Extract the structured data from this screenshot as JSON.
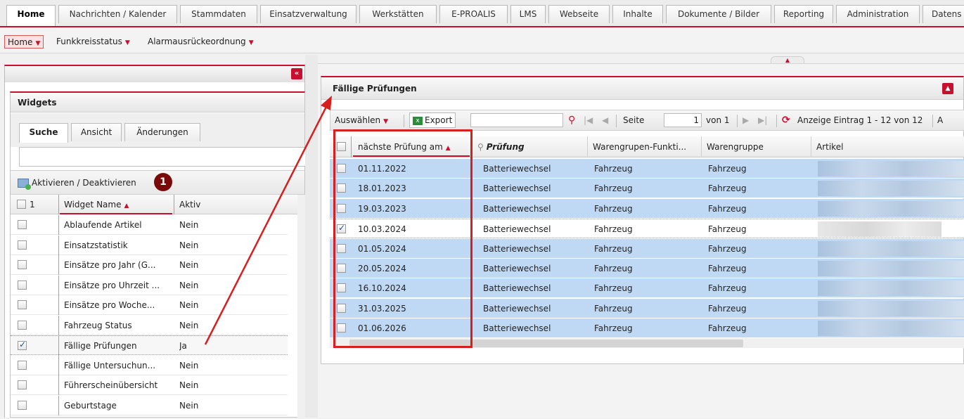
{
  "top_tabs": [
    "Home",
    "Nachrichten / Kalender",
    "Stammdaten",
    "Einsatzverwaltung",
    "Werkstätten",
    "E-PROALIS",
    "LMS",
    "Webseite",
    "Inhalte",
    "Dokumente / Bilder",
    "Reporting",
    "Administration",
    "Datens"
  ],
  "subnav": {
    "home": "Home",
    "funk": "Funkkreisstatus",
    "alarm": "Alarmausrückeordnung"
  },
  "left_panel": {
    "collapse_glyph": "«"
  },
  "widgets": {
    "title": "Widgets",
    "tabs": [
      "Suche",
      "Ansicht",
      "Änderungen"
    ],
    "activate_label": "Aktivieren / Deaktivieren",
    "badge": "1",
    "header": {
      "count": "1",
      "name": "Widget Name",
      "active": "Aktiv"
    },
    "rows": [
      {
        "name": "Ablaufende Artikel",
        "active": "Nein",
        "checked": false
      },
      {
        "name": "Einsatzstatistik",
        "active": "Nein",
        "checked": false
      },
      {
        "name": "Einsätze pro Jahr (G...",
        "active": "Nein",
        "checked": false
      },
      {
        "name": "Einsätze pro Uhrzeit ...",
        "active": "Nein",
        "checked": false
      },
      {
        "name": "Einsätze pro Woche...",
        "active": "Nein",
        "checked": false
      },
      {
        "name": "Fahrzeug Status",
        "active": "Nein",
        "checked": false
      },
      {
        "name": "Fällige Prüfungen",
        "active": "Ja",
        "checked": true
      },
      {
        "name": "Fällige Untersuchun...",
        "active": "Nein",
        "checked": false
      },
      {
        "name": "Führerscheinübersicht",
        "active": "Nein",
        "checked": false
      },
      {
        "name": "Geburtstage",
        "active": "Nein",
        "checked": false
      }
    ]
  },
  "faellig": {
    "title": "Fällige Prüfungen",
    "toolbar": {
      "select": "Auswählen",
      "export": "Export",
      "page_label": "Seite",
      "page_value": "1",
      "of": "von 1",
      "range": "Anzeige Eintrag 1 - 12 von 12",
      "trail": "A"
    },
    "columns": [
      "nächste Prüfung am",
      "Prüfung",
      "Warengrupen-Funkti...",
      "Warengruppe",
      "Artikel"
    ],
    "rows": [
      {
        "date": "01.11.2022",
        "pruefung": "Batteriewechsel",
        "wgf": "Fahrzeug",
        "wg": "Fahrzeug",
        "checked": false,
        "state": "blue"
      },
      {
        "date": "18.01.2023",
        "pruefung": "Batteriewechsel",
        "wgf": "Fahrzeug",
        "wg": "Fahrzeug",
        "checked": false,
        "state": "blue"
      },
      {
        "date": "19.03.2023",
        "pruefung": "Batteriewechsel",
        "wgf": "Fahrzeug",
        "wg": "Fahrzeug",
        "checked": false,
        "state": "blue"
      },
      {
        "date": "10.03.2024",
        "pruefung": "Batteriewechsel",
        "wgf": "Fahrzeug",
        "wg": "Fahrzeug",
        "checked": true,
        "state": "sel"
      },
      {
        "date": "01.05.2024",
        "pruefung": "Batteriewechsel",
        "wgf": "Fahrzeug",
        "wg": "Fahrzeug",
        "checked": false,
        "state": "blue"
      },
      {
        "date": "20.05.2024",
        "pruefung": "Batteriewechsel",
        "wgf": "Fahrzeug",
        "wg": "Fahrzeug",
        "checked": false,
        "state": "blue"
      },
      {
        "date": "16.10.2024",
        "pruefung": "Batteriewechsel",
        "wgf": "Fahrzeug",
        "wg": "Fahrzeug",
        "checked": false,
        "state": "blue"
      },
      {
        "date": "31.03.2025",
        "pruefung": "Batteriewechsel",
        "wgf": "Fahrzeug",
        "wg": "Fahrzeug",
        "checked": false,
        "state": "blue"
      },
      {
        "date": "01.06.2026",
        "pruefung": "Batteriewechsel",
        "wgf": "Fahrzeug",
        "wg": "Fahrzeug",
        "checked": false,
        "state": "blue"
      }
    ]
  },
  "colors": {
    "accent": "#c8102e",
    "row_blue": "#bfd9f5",
    "annotation": "#d61f1f"
  }
}
